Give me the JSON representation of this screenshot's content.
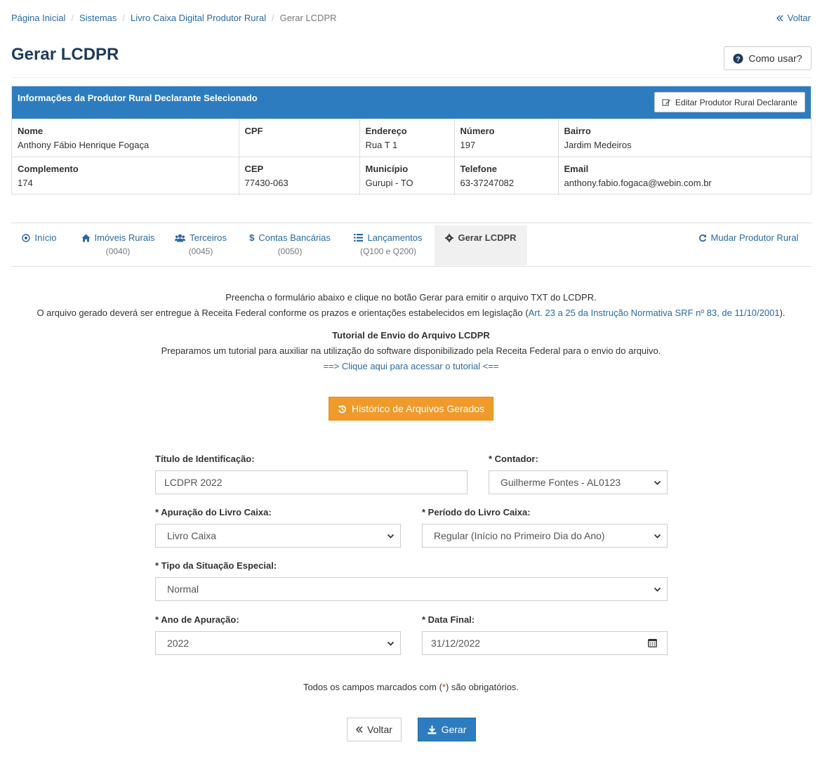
{
  "breadcrumb": [
    "Página Inicial",
    "Sistemas",
    "Livro Caixa Digital Produtor Rural",
    "Gerar LCDPR"
  ],
  "back_top": "Voltar",
  "page_title": "Gerar LCDPR",
  "help_button": "Como usar?",
  "panel": {
    "title": "Informações da Produtor Rural Declarante Selecionado",
    "edit_button": "Editar Produtor Rural Declarante",
    "row1": [
      {
        "label": "Nome",
        "value": "Anthony Fábio Henrique Fogaça"
      },
      {
        "label": "CPF",
        "value": ""
      },
      {
        "label": "Endereço",
        "value": "Rua T 1"
      },
      {
        "label": "Número",
        "value": "197"
      },
      {
        "label": "Bairro",
        "value": "Jardim Medeiros"
      }
    ],
    "row2": [
      {
        "label": "Complemento",
        "value": "174"
      },
      {
        "label": "CEP",
        "value": "77430-063"
      },
      {
        "label": "Município",
        "value": "Gurupi - TO"
      },
      {
        "label": "Telefone",
        "value": "63-37247082"
      },
      {
        "label": "Email",
        "value": "anthony.fabio.fogaca@webin.com.br"
      }
    ]
  },
  "tabs": [
    {
      "label": "Início",
      "sub": "",
      "icon": "target-icon"
    },
    {
      "label": "Imóveis Rurais",
      "sub": "(0040)",
      "icon": "home-icon"
    },
    {
      "label": "Terceiros",
      "sub": "(0045)",
      "icon": "users-icon"
    },
    {
      "label": "Contas Bancárias",
      "sub": "(0050)",
      "icon": "dollar-icon"
    },
    {
      "label": "Lançamentos",
      "sub": "(Q100 e Q200)",
      "icon": "list-icon"
    },
    {
      "label": "Gerar LCDPR",
      "sub": "",
      "icon": "gear-icon"
    },
    {
      "label": "Mudar Produtor Rural",
      "sub": "",
      "icon": "refresh-icon"
    }
  ],
  "intro": {
    "line1": "Preencha o formulário abaixo e clique no botão Gerar para emitir o arquivo TXT do LCDPR.",
    "line2_prefix": "O arquivo gerado deverá ser entregue à Receita Federal conforme os prazos e orientações estabelecidos em legislação (",
    "line2_link": "Art. 23 a 25 da Instrução Normativa SRF nº 83, de 11/10/2001",
    "line2_suffix": ").",
    "tutorial_title": "Tutorial de Envio do Arquivo LCDPR",
    "tutorial_text": "Preparamos um tutorial para auxiliar na utilização do software disponibilizado pela Receita Federal para o envio do arquivo.",
    "tutorial_link": "==> Clique aqui para acessar o tutorial <=="
  },
  "history_button": "Histórico de Arquivos Gerados",
  "form": {
    "titulo_label": "Título de Identificação:",
    "titulo_value": "LCDPR 2022",
    "contador_label": "* Contador:",
    "contador_value": "Guilherme Fontes - AL0123",
    "apuracao_label": "* Apuração do Livro Caixa:",
    "apuracao_value": "Livro Caixa",
    "periodo_label": "* Período do Livro Caixa:",
    "periodo_value": "Regular (Início no Primeiro Dia do Ano)",
    "situacao_label": "* Tipo da Situação Especial:",
    "situacao_value": "Normal",
    "ano_label": "* Ano de Apuração:",
    "ano_value": "2022",
    "data_label": "* Data Final:",
    "data_value": "31/12/2022"
  },
  "note": {
    "prefix": "Todos os campos marcados com (",
    "star": "*",
    "suffix": ") são obrigatórios."
  },
  "buttons": {
    "back": "Voltar",
    "generate": "Gerar"
  },
  "colors": {
    "primary": "#2d7cc0",
    "orange": "#f09a2b",
    "title": "#1f3b5c",
    "link": "#2a6aa4"
  }
}
